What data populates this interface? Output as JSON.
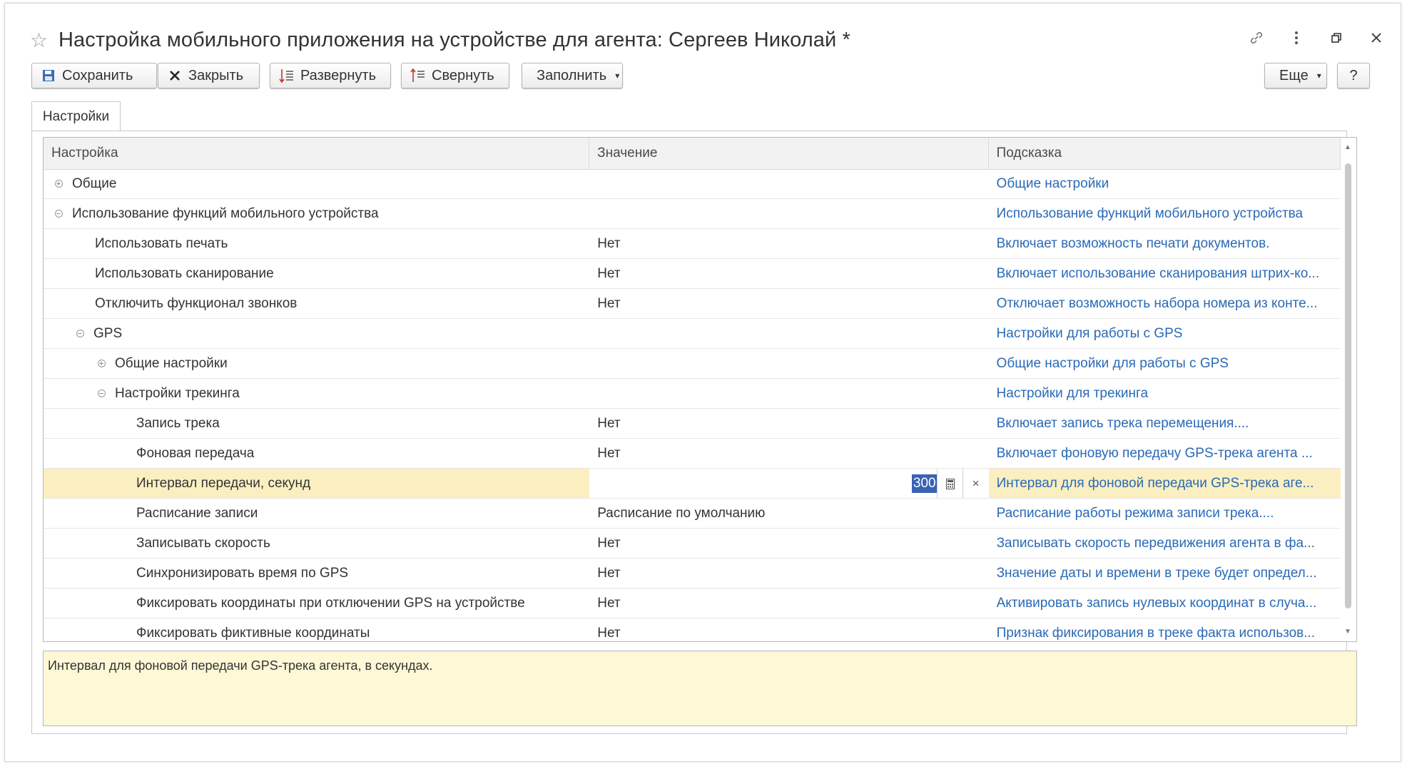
{
  "window": {
    "title": "Настройка мобильного приложения на устройстве для агента: Сергеев Николай *",
    "icons": [
      "star-icon",
      "link-icon",
      "more-icon",
      "restore-icon",
      "close-icon"
    ]
  },
  "toolbar": {
    "save_label": "Сохранить",
    "close_label": "Закрыть",
    "expand_label": "Развернуть",
    "collapse_label": "Свернуть",
    "fill_label": "Заполнить",
    "more_label": "Еще",
    "help_label": "?"
  },
  "tabs": [
    {
      "label": "Настройки"
    }
  ],
  "grid": {
    "columns": [
      "Настройка",
      "Значение",
      "Подсказка"
    ],
    "rows": [
      {
        "name": "Общие",
        "value": "",
        "hint": "Общие настройки"
      },
      {
        "name": "Использование функций мобильного устройства",
        "value": "",
        "hint": "Использование функций мобильного устройства"
      },
      {
        "name": "Использовать печать",
        "value": "Нет",
        "hint": "Включает возможность печати документов."
      },
      {
        "name": "Использовать сканирование",
        "value": "Нет",
        "hint": "Включает использование сканирования штрих-ко..."
      },
      {
        "name": "Отключить функционал звонков",
        "value": "Нет",
        "hint": "Отключает возможность набора номера из конте..."
      },
      {
        "name": "GPS",
        "value": "",
        "hint": "Настройки для работы с GPS"
      },
      {
        "name": "Общие настройки",
        "value": "",
        "hint": "Общие настройки для работы с GPS"
      },
      {
        "name": "Настройки трекинга",
        "value": "",
        "hint": "Настройки для трекинга"
      },
      {
        "name": "Запись трека",
        "value": "Нет",
        "hint": "Включает запись трека перемещения...."
      },
      {
        "name": "Фоновая передача",
        "value": "Нет",
        "hint": "Включает фоновую передачу GPS-трека агента ..."
      },
      {
        "name": "Интервал передачи, секунд",
        "value": "300",
        "hint": "Интервал для фоновой передачи GPS-трека аге..."
      },
      {
        "name": "Расписание записи",
        "value": "Расписание по умолчанию",
        "hint": "Расписание работы режима записи трека...."
      },
      {
        "name": "Записывать скорость",
        "value": "Нет",
        "hint": "Записывать скорость передвижения агента в фа..."
      },
      {
        "name": "Синхронизировать время по GPS",
        "value": "Нет",
        "hint": "Значение даты и времени в треке будет определ..."
      },
      {
        "name": "Фиксировать координаты при отключении GPS на устройстве",
        "value": "Нет",
        "hint": "Активировать запись нулевых координат в случа..."
      },
      {
        "name": "Фиксировать фиктивные координаты",
        "value": "Нет",
        "hint": "Признак фиксирования в треке факта использов..."
      }
    ]
  },
  "description": "Интервал для фоновой передачи GPS-трека агента, в секундах.",
  "colors": {
    "accent_link": "#2a6ab6",
    "selection": "#fbefc1",
    "description_bg": "#fef8d6"
  }
}
